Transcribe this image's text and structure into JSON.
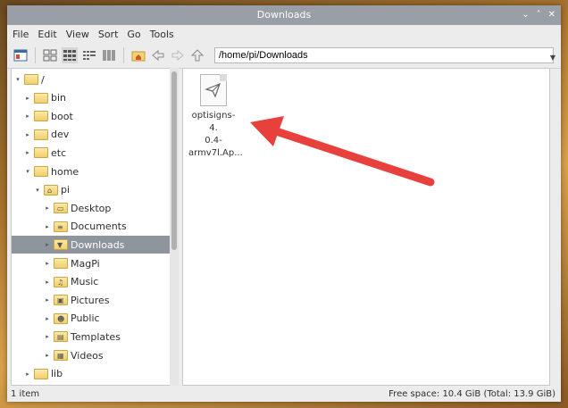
{
  "window": {
    "title": "Downloads",
    "controls": [
      "⌄",
      "˄",
      "✕"
    ]
  },
  "menu": [
    "File",
    "Edit",
    "View",
    "Sort",
    "Go",
    "Tools"
  ],
  "path": {
    "value": "/home/pi/Downloads"
  },
  "tree": [
    {
      "label": "/",
      "expander": "▾",
      "indent": 0
    },
    {
      "label": "bin",
      "expander": "▸",
      "indent": 1
    },
    {
      "label": "boot",
      "expander": "▸",
      "indent": 1
    },
    {
      "label": "dev",
      "expander": "▸",
      "indent": 1
    },
    {
      "label": "etc",
      "expander": "▸",
      "indent": 1
    },
    {
      "label": "home",
      "expander": "▾",
      "indent": 1
    },
    {
      "label": "pi",
      "expander": "▾",
      "indent": 2,
      "glyph": "⌂"
    },
    {
      "label": "Desktop",
      "expander": "▸",
      "indent": 3,
      "glyph": "▭"
    },
    {
      "label": "Documents",
      "expander": "▸",
      "indent": 3,
      "glyph": "≡"
    },
    {
      "label": "Downloads",
      "expander": "▸",
      "indent": 3,
      "glyph": "▼",
      "selected": true
    },
    {
      "label": "MagPi",
      "expander": "▸",
      "indent": 3
    },
    {
      "label": "Music",
      "expander": "▸",
      "indent": 3,
      "glyph": "♫"
    },
    {
      "label": "Pictures",
      "expander": "▸",
      "indent": 3,
      "glyph": "▣"
    },
    {
      "label": "Public",
      "expander": "▸",
      "indent": 3,
      "glyph": "☻"
    },
    {
      "label": "Templates",
      "expander": "▸",
      "indent": 3,
      "glyph": "▤"
    },
    {
      "label": "Videos",
      "expander": "▸",
      "indent": 3,
      "glyph": "▦"
    },
    {
      "label": "lib",
      "expander": "▸",
      "indent": 1
    }
  ],
  "files": [
    {
      "name_lines": [
        "optisigns-4.",
        "0.4-",
        "armv7l.Ap..."
      ],
      "icon": "paper-plane-file-icon"
    }
  ],
  "status": {
    "left": "1 item",
    "right": "Free space: 10.4 GiB (Total: 13.9 GiB)"
  },
  "colors": {
    "titlebar": "#9a9ea6",
    "selection": "#8f959c",
    "arrow": "#e8413d"
  }
}
